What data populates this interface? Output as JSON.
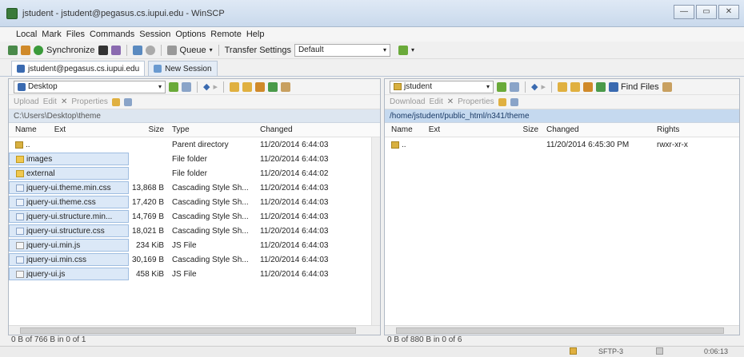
{
  "window": {
    "title": "jstudent - jstudent@pegasus.cs.iupui.edu - WinSCP",
    "minimize": "—",
    "maximize": "▭",
    "close": "✕"
  },
  "menu": [
    "Local",
    "Mark",
    "Files",
    "Commands",
    "Session",
    "Options",
    "Remote",
    "Help"
  ],
  "toolbar": {
    "synchronize": "Synchronize",
    "queue": "Queue",
    "transfer_settings": "Transfer Settings",
    "transfer_value": "Default"
  },
  "tabs": [
    {
      "label": "jstudent@pegasus.cs.iupui.edu"
    },
    {
      "label": "New Session"
    }
  ],
  "left": {
    "location": "Desktop",
    "path": "C:\\Users\\Desktop\\theme",
    "toolbar2": [
      "Upload",
      "Edit",
      "Properties"
    ],
    "columns": {
      "name": "Name",
      "ext": "Ext",
      "size": "Size",
      "type": "Type",
      "changed": "Changed"
    },
    "rows": [
      {
        "icon": "up",
        "name": "..",
        "size": "",
        "type": "Parent directory",
        "changed": "11/20/2014 6:44:03"
      },
      {
        "icon": "folder",
        "name": "images",
        "size": "",
        "type": "File folder",
        "changed": "11/20/2014 6:44:03"
      },
      {
        "icon": "folder",
        "name": "external",
        "size": "",
        "type": "File folder",
        "changed": "11/20/2014 6:44:02"
      },
      {
        "icon": "css",
        "name": "jquery-ui.theme.min.css",
        "size": "13,868 B",
        "type": "Cascading Style Sh...",
        "changed": "11/20/2014 6:44:03"
      },
      {
        "icon": "css",
        "name": "jquery-ui.theme.css",
        "size": "17,420 B",
        "type": "Cascading Style Sh...",
        "changed": "11/20/2014 6:44:03"
      },
      {
        "icon": "css",
        "name": "jquery-ui.structure.min...",
        "size": "14,769 B",
        "type": "Cascading Style Sh...",
        "changed": "11/20/2014 6:44:03"
      },
      {
        "icon": "css",
        "name": "jquery-ui.structure.css",
        "size": "18,021 B",
        "type": "Cascading Style Sh...",
        "changed": "11/20/2014 6:44:03"
      },
      {
        "icon": "js",
        "name": "jquery-ui.min.js",
        "size": "234 KiB",
        "type": "JS File",
        "changed": "11/20/2014 6:44:03"
      },
      {
        "icon": "css",
        "name": "jquery-ui.min.css",
        "size": "30,169 B",
        "type": "Cascading Style Sh...",
        "changed": "11/20/2014 6:44:03"
      },
      {
        "icon": "js",
        "name": "jquery-ui.js",
        "size": "458 KiB",
        "type": "JS File",
        "changed": "11/20/2014 6:44:03"
      }
    ],
    "status": "0 B of 766 B in 0 of 1"
  },
  "right": {
    "location": "jstudent",
    "find_files": "Find Files",
    "path": "/home/jstudent/public_html/n341/theme",
    "toolbar2": [
      "Download",
      "Edit",
      "Properties"
    ],
    "columns": {
      "name": "Name",
      "ext": "Ext",
      "size": "Size",
      "changed": "Changed",
      "rights": "Rights"
    },
    "rows": [
      {
        "icon": "up",
        "name": "..",
        "size": "",
        "changed": "11/20/2014 6:45:30 PM",
        "rights": "rwxr-xr-x"
      }
    ],
    "status": "0 B of 880 B in 0 of 6"
  },
  "statusbar": {
    "protocol": "SFTP-3",
    "time": "0:06:13"
  },
  "colors": {
    "selection": "#dbe8f7",
    "path_remote": "#c5d9ef"
  }
}
